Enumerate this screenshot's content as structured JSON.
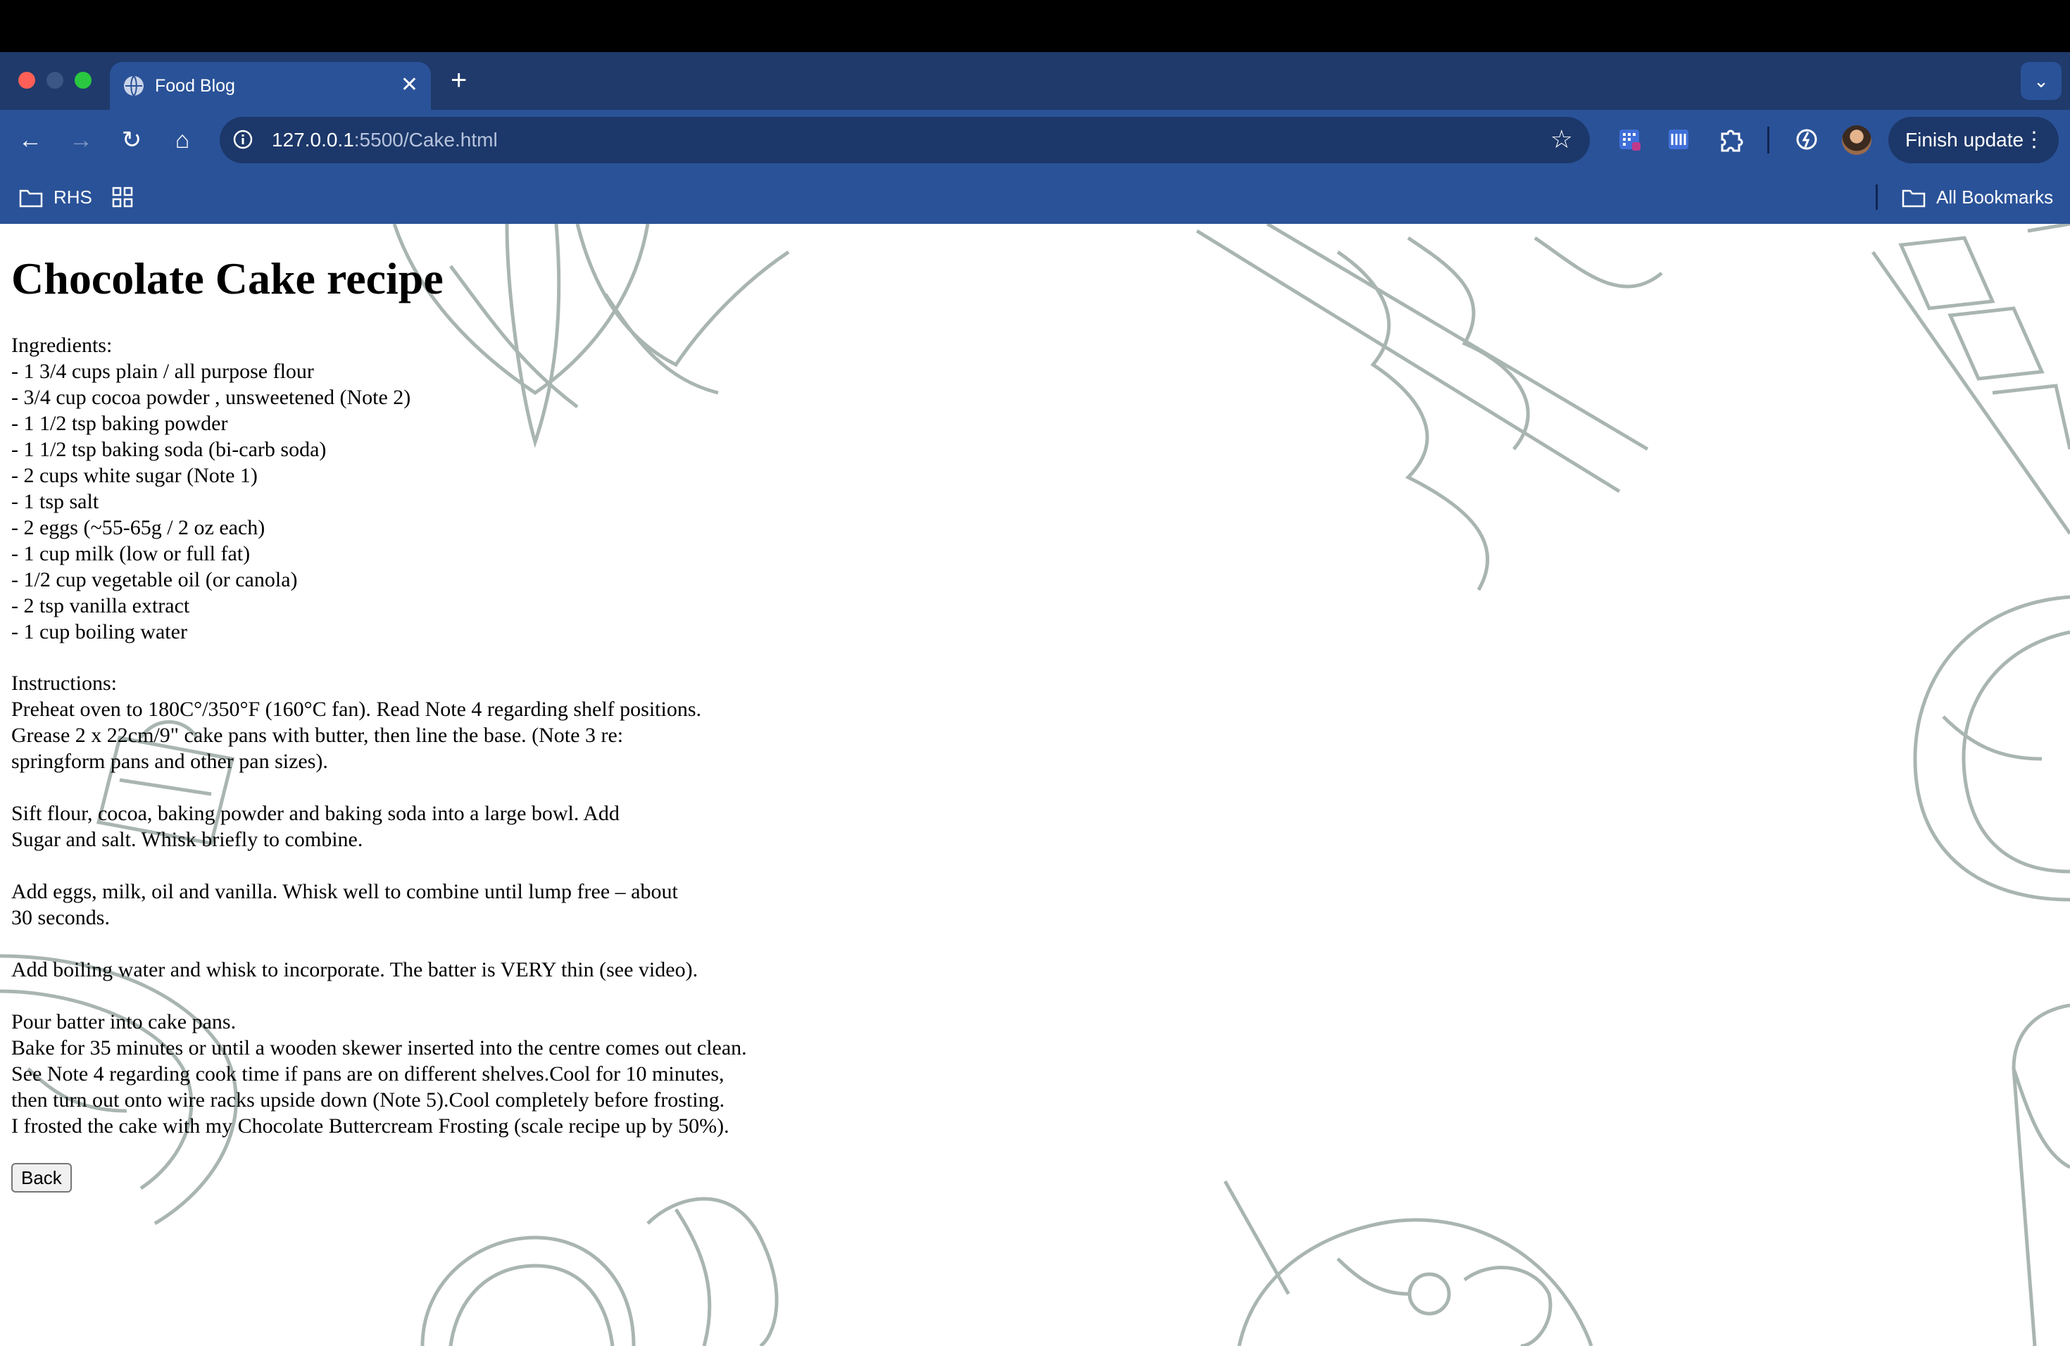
{
  "browser": {
    "tab_title": "Food Blog",
    "url_host": "127.0.0.1",
    "url_path": ":5500/Cake.html",
    "finish_update_label": "Finish update",
    "bookmarks": {
      "folder_label": "RHS",
      "all_bookmarks_label": "All Bookmarks"
    },
    "icons": [
      "globe-icon",
      "close-icon",
      "plus-icon",
      "chevron-down-icon",
      "back-arrow-icon",
      "forward-arrow-icon",
      "reload-icon",
      "home-icon",
      "site-info-icon",
      "star-icon",
      "extension-icon",
      "puzzle-icon",
      "performance-icon",
      "avatar",
      "more-vert-icon",
      "folder-icon",
      "apps-grid-icon"
    ]
  },
  "recipe": {
    "title": "Chocolate Cake recipe",
    "ingredients_heading": "Ingredients:",
    "ingredients": [
      "- 1 3/4 cups plain / all purpose flour",
      "- 3/4 cup cocoa powder , unsweetened (Note 2)",
      "- 1 1/2 tsp baking powder",
      "- 1 1/2 tsp baking soda (bi-carb soda)",
      "- 2 cups white sugar (Note 1)",
      "- 1 tsp salt",
      "- 2 eggs (~55-65g / 2 oz each)",
      "- 1 cup milk (low or full fat)",
      "- 1/2 cup vegetable oil (or canola)",
      "- 2 tsp vanilla extract",
      "- 1 cup boiling water"
    ],
    "instructions_heading": "Instructions:",
    "instructions": [
      [
        "Preheat oven to 180C°/350°F (160°C fan). Read Note 4 regarding shelf positions.",
        "Grease 2 x 22cm/9\" cake pans with butter, then line the base. (Note 3 re:",
        "springform pans and other pan sizes)."
      ],
      [
        "Sift flour, cocoa, baking powder and baking soda into a large bowl. Add",
        "Sugar and salt. Whisk briefly to combine."
      ],
      [
        "Add eggs, milk, oil and vanilla. Whisk well to combine until lump free – about",
        "30 seconds."
      ],
      [
        "Add boiling water and whisk to incorporate. The batter is VERY thin (see video)."
      ],
      [
        "Pour batter into cake pans.",
        "Bake for 35 minutes or until a wooden skewer inserted into the centre comes out clean.",
        "See Note 4 regarding cook time if pans are on different shelves.Cool for 10 minutes,",
        "then turn out onto wire racks upside down (Note 5).Cool completely before frosting.",
        "I frosted the cake with my Chocolate Buttercream Frosting (scale recipe up by 50%)."
      ]
    ],
    "back_label": "Back"
  },
  "colors": {
    "tabstrip": "#1f3a6b",
    "toolbar": "#2a5298",
    "omnibox": "#1c3769",
    "illustration": "#a9b5b0"
  }
}
